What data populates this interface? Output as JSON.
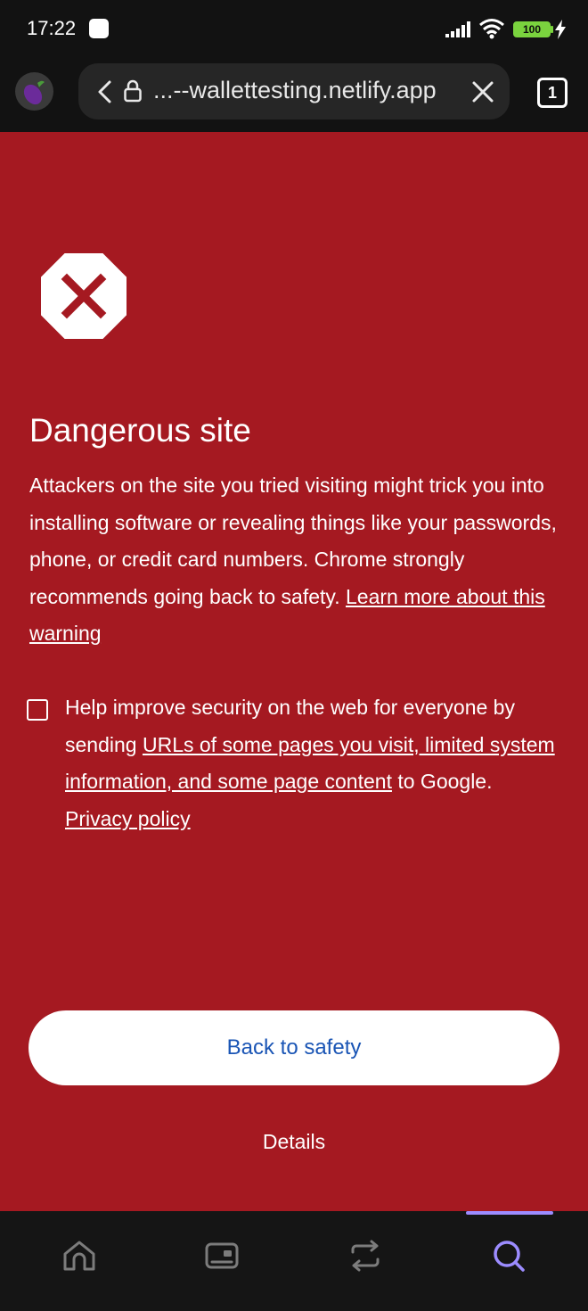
{
  "status_bar": {
    "time": "17:22",
    "battery": "100"
  },
  "browser": {
    "url": "...--wallettesting.netlify.app",
    "tab_count": "1"
  },
  "page": {
    "title": "Dangerous site",
    "body": "Attackers on the site you tried visiting might trick you into installing software or revealing things like your passwords, phone, or credit card numbers. Chrome strongly recommends going back to safety.",
    "learn_more_link": "Learn more about this warning",
    "option_text_prefix": "Help improve security on the web for everyone by sending",
    "option_link": "URLs of some pages you visit, limited system information, and some page content",
    "option_text_mid": "to Google.",
    "privacy_link": "Privacy policy",
    "checkbox_checked": false,
    "primary_button": "Back to safety",
    "details_button": "Details"
  },
  "colors": {
    "background": "#a51921",
    "button_text": "#1a55b5",
    "nav_active": "#9c8cff"
  },
  "bottom_nav": [
    {
      "icon": "home-icon"
    },
    {
      "icon": "wallet-icon"
    },
    {
      "icon": "swap-icon"
    },
    {
      "icon": "search-icon",
      "active": true
    }
  ]
}
